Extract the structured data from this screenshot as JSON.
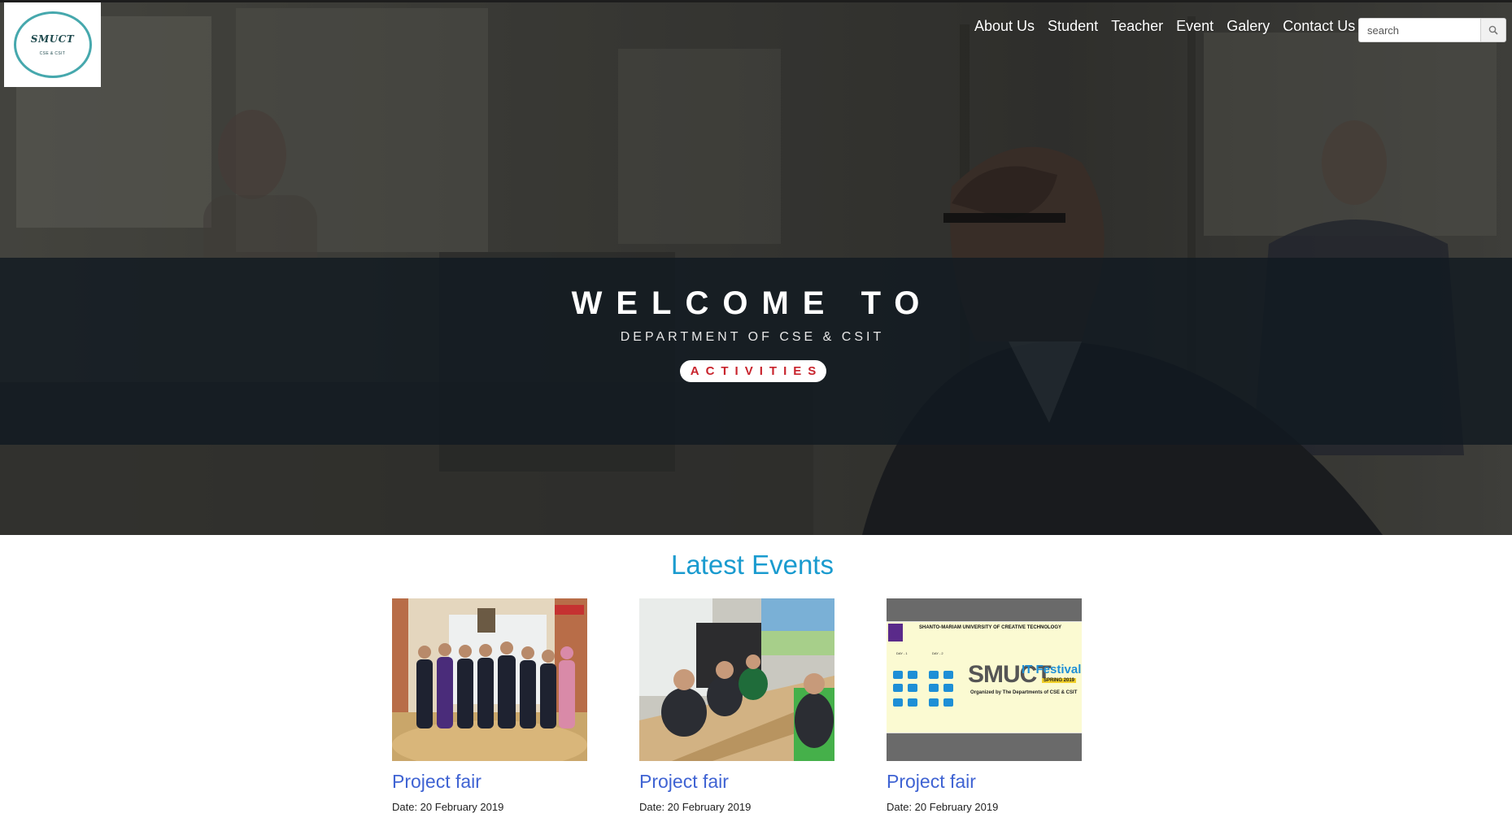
{
  "brand": {
    "logo_text": "SMUCT",
    "logo_sub": "CSE & CSIT"
  },
  "nav": {
    "items": [
      "About Us",
      "Student",
      "Teacher",
      "Event",
      "Galery",
      "Contact Us"
    ]
  },
  "search": {
    "placeholder": "search",
    "icon": "search-icon"
  },
  "hero": {
    "title": "WELCOME TO",
    "subtitle": "DEPARTMENT OF CSE & CSIT",
    "button_label": "ACTIVITIES",
    "button_color": "#c8232c"
  },
  "events": {
    "heading": "Latest Events",
    "heading_color": "#1a9bcf",
    "items": [
      {
        "title": "Project fair",
        "date": "Date: 20 February 2019",
        "image": "group-photo"
      },
      {
        "title": "Project fair",
        "date": "Date: 20 February 2019",
        "image": "meeting-photo"
      },
      {
        "title": "Project fair",
        "date": "Date: 20 February 2019",
        "image": "it-festival-poster",
        "poster_header": "SHANTO-MARIAM UNIVERSITY OF CREATIVE TECHNOLOGY",
        "poster_brand": "SMUCT",
        "poster_title": "IT Festival",
        "poster_season": "SPRING 2019",
        "poster_org": "Organized by The Departments of CSE & CSIT",
        "poster_day1": "DAY - 1",
        "poster_day2": "DAY - 2"
      }
    ]
  }
}
